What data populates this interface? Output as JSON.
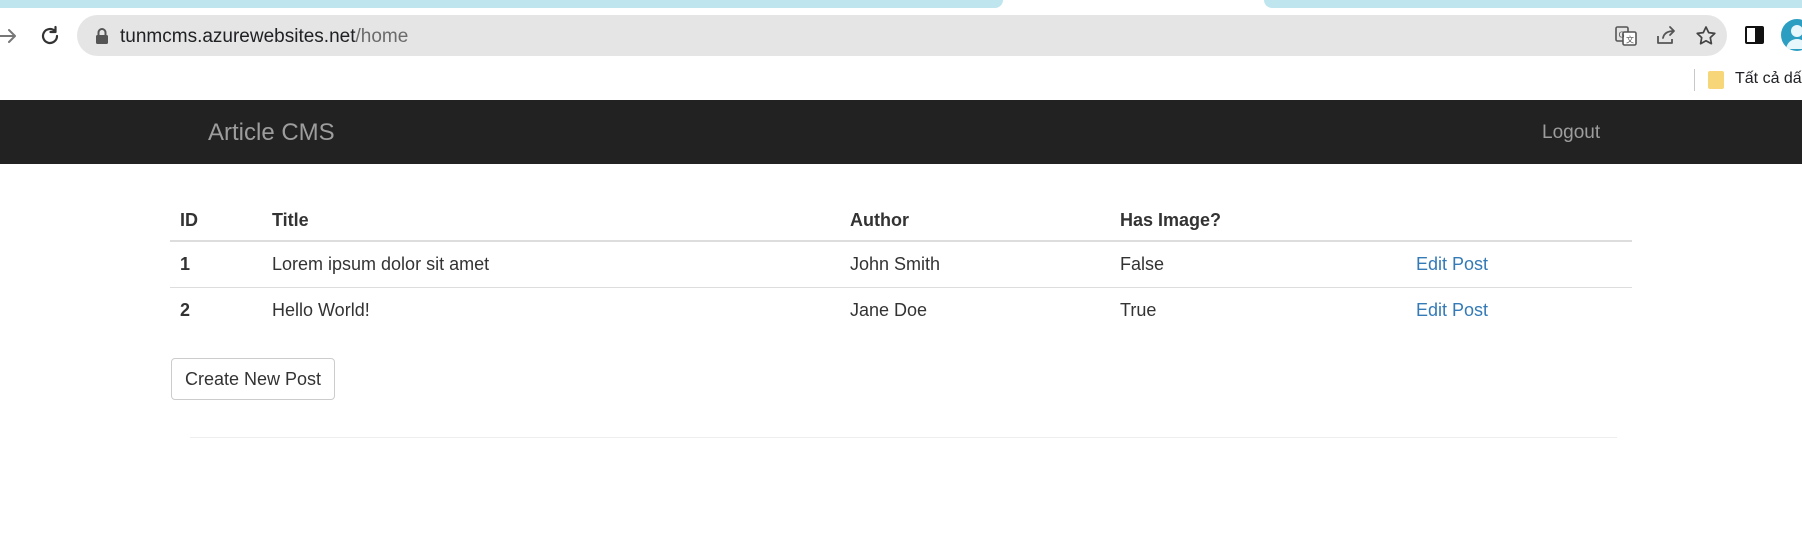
{
  "browser": {
    "url_host": "tunmcms.azurewebsites.net",
    "url_path": "/home",
    "bookmark_label": "Tất cả dấu",
    "accent": "#bfe6ee"
  },
  "navbar": {
    "brand": "Article CMS",
    "logout": "Logout",
    "background": "#222222"
  },
  "table": {
    "headers": [
      "ID",
      "Title",
      "Author",
      "Has Image?",
      ""
    ],
    "rows": [
      {
        "id": "1",
        "title": "Lorem ipsum dolor sit amet",
        "author": "John Smith",
        "has_image": "False",
        "action": "Edit Post"
      },
      {
        "id": "2",
        "title": "Hello World!",
        "author": "Jane Doe",
        "has_image": "True",
        "action": "Edit Post"
      }
    ],
    "link_color": "#337ab7"
  },
  "actions": {
    "create_label": "Create New Post"
  },
  "icons": [
    "forward-icon",
    "reload-icon",
    "lock-icon",
    "translate-icon",
    "share-icon",
    "star-icon",
    "side-panel-icon",
    "profile-icon",
    "bookmark-folder-icon"
  ]
}
